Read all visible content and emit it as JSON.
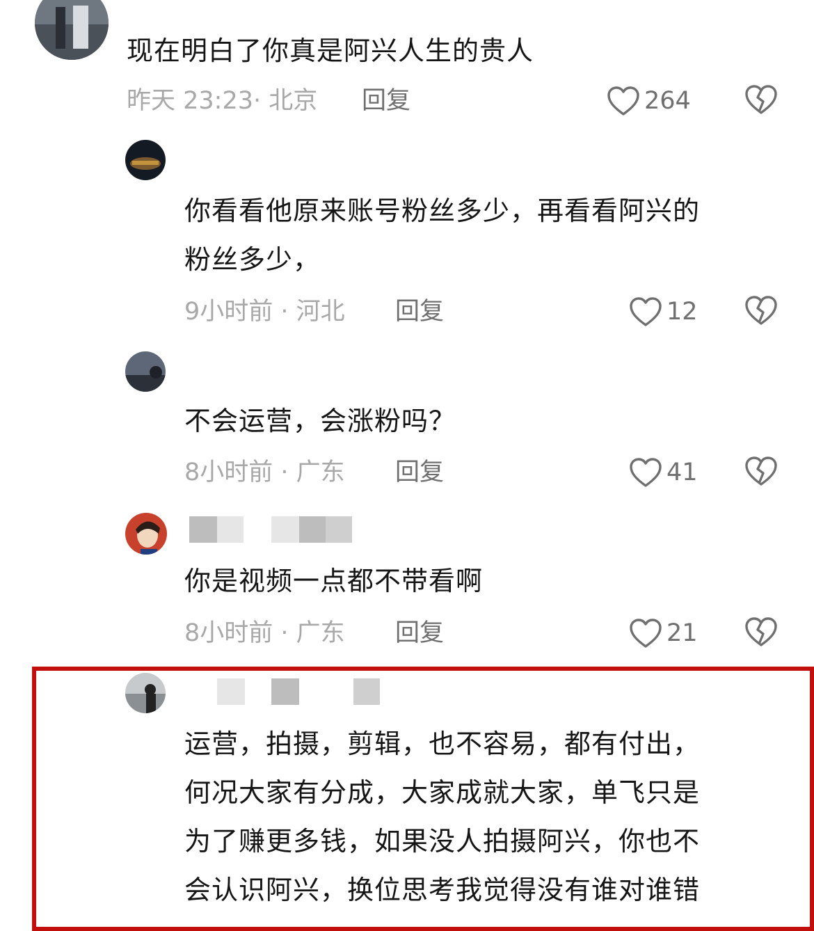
{
  "comments": [
    {
      "lines": [
        "现在明白了你真是阿兴人生的贵人"
      ],
      "meta": "昨天 23:23· 北京",
      "reply": "回复",
      "likes": "264"
    },
    {
      "lines": [
        "你看看他原来账号粉丝多少，再看看阿兴的",
        "粉丝多少，"
      ],
      "meta": "9小时前 · 河北",
      "reply": "回复",
      "likes": "12"
    },
    {
      "lines": [
        "不会运营，会涨粉吗？"
      ],
      "meta": "8小时前 · 广东",
      "reply": "回复",
      "likes": "41"
    },
    {
      "lines": [
        "你是视频一点都不带看啊"
      ],
      "meta": "8小时前 · 广东",
      "reply": "回复",
      "likes": "21"
    },
    {
      "lines": [
        "运营，拍摄，剪辑，也不容易，都有付出，",
        "何况大家有分成，大家成就大家，单飞只是",
        "为了赚更多钱，如果没人拍摄阿兴，你也不",
        "会认识阿兴，换位思考我觉得没有谁对谁错"
      ]
    }
  ],
  "icons": {
    "like": "heart-outline-icon",
    "dislike": "broken-heart-icon"
  },
  "colors": {
    "text": "#151515",
    "meta": "#a8a8a8",
    "action": "#6f6f6f",
    "highlight_border": "#c10f0b"
  }
}
